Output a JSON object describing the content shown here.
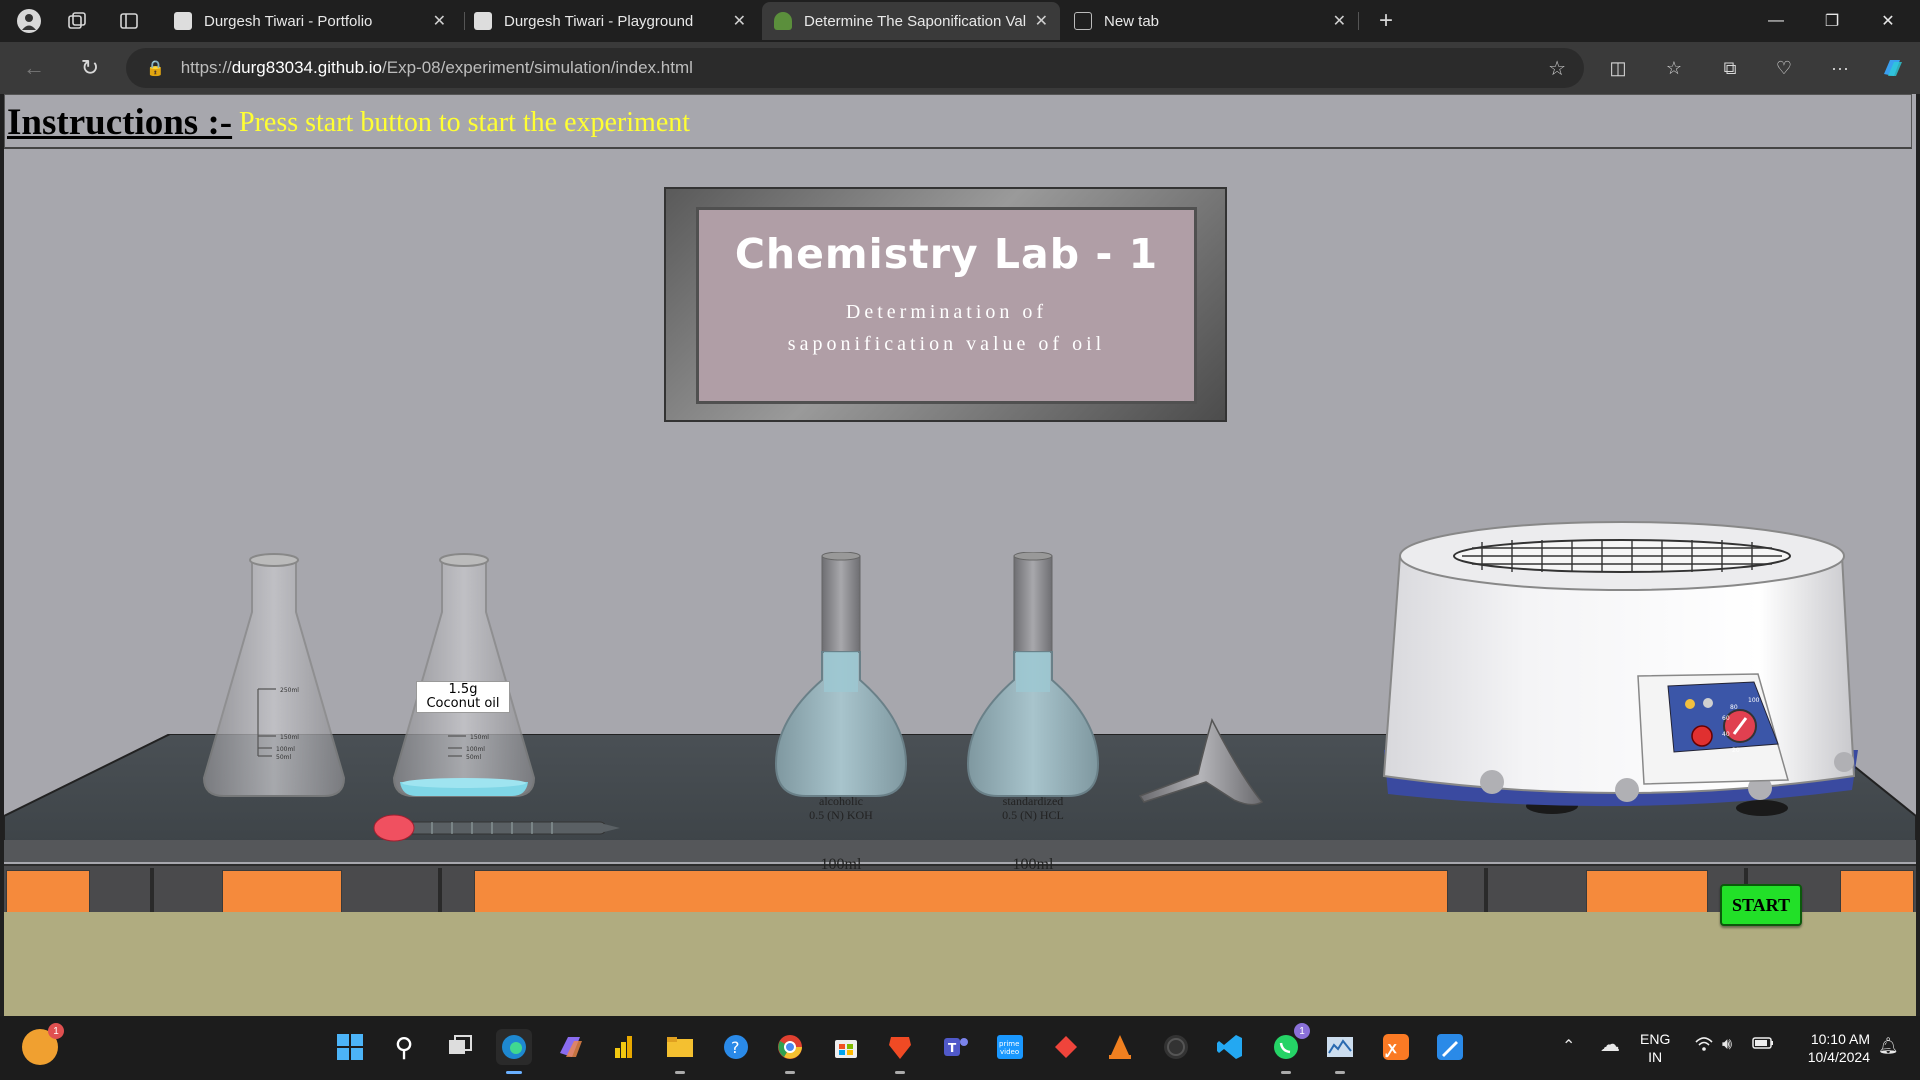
{
  "browser": {
    "tabs": [
      {
        "title": "Durgesh Tiwari - Portfolio",
        "active": false
      },
      {
        "title": "Durgesh Tiwari - Playground",
        "active": false
      },
      {
        "title": "Determine The Saponification Val",
        "active": true
      },
      {
        "title": "New tab",
        "active": false
      }
    ],
    "url_prefix": "https://",
    "url_domain": "durg83034.github.io",
    "url_path": "/Exp-08/experiment/simulation/index.html"
  },
  "page": {
    "instructions_label": "Instructions :-",
    "instructions_text": "Press start button to start the experiment",
    "board_title": "Chemistry Lab - 1",
    "board_subtitle": "Determination of saponification value of oil",
    "flask_label": "1.5g Coconut oil",
    "flask_marks": [
      "250ml",
      "150ml",
      "100ml",
      "50ml"
    ],
    "koh_flask": {
      "line1": "alcoholic",
      "line2": "0.5 (N) KOH",
      "volume": "100ml"
    },
    "hcl_flask": {
      "line1": "standardized",
      "line2": "0.5 (N) HCL",
      "volume": "100ml"
    },
    "heater_dial": [
      "20",
      "40",
      "60",
      "80",
      "100"
    ],
    "start_button": "START",
    "colors": {
      "instruction": "#ffff33",
      "wall": "#a7a7ad",
      "drawers": "#f58a3c",
      "start": "#22e028"
    }
  },
  "taskbar": {
    "lang": "ENG",
    "region": "IN",
    "time": "10:10 AM",
    "date": "10/4/2024",
    "notification_badge": "1",
    "whatsapp_badge": "1"
  }
}
